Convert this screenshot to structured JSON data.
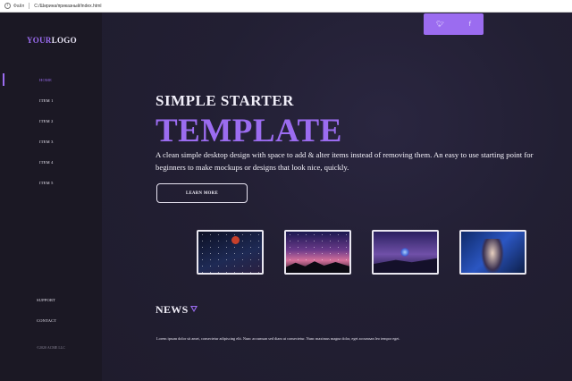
{
  "browser": {
    "info_label": "Файл",
    "url": "C:/Ширина/приказный/index.html",
    "info_icon": "info-icon"
  },
  "logo": {
    "part1": "YOUR",
    "part2": "LOGO"
  },
  "nav": {
    "items": [
      {
        "label": "HOME"
      },
      {
        "label": "ITEM 1"
      },
      {
        "label": "ITEM 2"
      },
      {
        "label": "ITEM 3"
      },
      {
        "label": "ITEM 4"
      },
      {
        "label": "ITEM 5"
      }
    ],
    "secondary": [
      {
        "label": "SUPPORT"
      },
      {
        "label": "CONTACT"
      }
    ]
  },
  "copyright": "©2020 ACME LLC",
  "social": {
    "twitter_icon": "twitter-icon",
    "facebook_icon": "facebook-icon"
  },
  "hero": {
    "kicker": "SIMPLE STARTER",
    "headline": "TEMPLATE",
    "description": "A clean simple desktop design with space to add & alter items instead of removing them. An easy to use starting point for beginners to make mockups or designs that look nice, quickly.",
    "button": "LEARN MORE"
  },
  "news": {
    "title": "NEWS",
    "body": "Lorem ipsum dolor sit amet, consectetur adipiscing elit. Nunc accumsan sed diam ut consectetur. Nunc maximus magna dolor, eget accumsan leo tempor eget."
  },
  "colors": {
    "accent": "#9b6cf0",
    "sidebar": "#1b1824",
    "background": "#221f33"
  }
}
